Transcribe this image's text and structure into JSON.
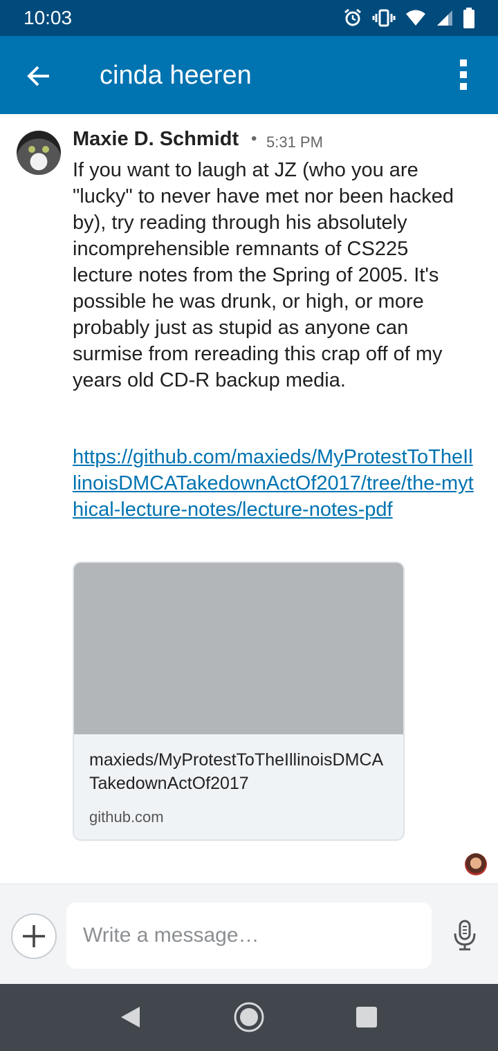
{
  "status_bar": {
    "time": "10:03",
    "icons": [
      "alarm-icon",
      "vibrate-icon",
      "wifi-icon",
      "signal-icon",
      "battery-icon"
    ]
  },
  "app_bar": {
    "title": "cinda heeren",
    "background": "#0073b1"
  },
  "message": {
    "sender": "Maxie D. Schmidt",
    "separator": "•",
    "time": "5:31 PM",
    "body": "If you want to laugh at JZ (who you are \"lucky\" to never have met nor been hacked by), try reading through his absolutely incomprehensible remnants of CS225 lecture notes from the Spring of 2005. It's possible he was drunk, or high, or more probably just as stupid as anyone can surmise from rereading this crap off of my years old CD-R backup media.",
    "link": "https://github.com/maxieds/MyProtestToTheIllinoisDMCATakedownActOf2017/tree/the-mythical-lecture-notes/lecture-notes-pdf",
    "preview": {
      "title": "maxieds/MyProtestToTheIllinoisDMCATakedownActOf2017",
      "domain": "github.com"
    }
  },
  "composer": {
    "placeholder": "Write a message…"
  },
  "colors": {
    "link": "#0073b1",
    "status_bar": "#004b7c",
    "nav_bar": "#42474d"
  }
}
